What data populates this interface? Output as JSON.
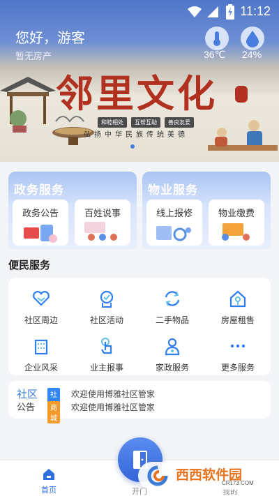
{
  "status_bar": {
    "time": "11:12"
  },
  "header": {
    "greeting": "您好，游客",
    "subtitle": "暂无房产",
    "temperature": "36℃",
    "humidity": "24%"
  },
  "banner": {
    "title": "邻里文化",
    "tags": [
      "和睦相处",
      "互帮互助",
      "善良友爱"
    ],
    "subtitle": "弘扬中华民族传统美德",
    "active_slide": 1
  },
  "services": {
    "government": {
      "title": "政务服务",
      "items": [
        {
          "label": "政务公告"
        },
        {
          "label": "百姓说事"
        }
      ]
    },
    "property": {
      "title": "物业服务",
      "items": [
        {
          "label": "线上报修"
        },
        {
          "label": "物业缴费"
        }
      ]
    }
  },
  "convenience": {
    "title": "便民服务",
    "items": [
      {
        "label": "社区周边",
        "icon": "heart-hands-icon"
      },
      {
        "label": "社区活动",
        "icon": "medal-icon"
      },
      {
        "label": "二手物品",
        "icon": "recycle-icon"
      },
      {
        "label": "房屋租售",
        "icon": "house-rent-icon"
      },
      {
        "label": "企业风采",
        "icon": "building-icon"
      },
      {
        "label": "业主报事",
        "icon": "hand-tap-icon"
      },
      {
        "label": "家政服务",
        "icon": "worker-icon"
      },
      {
        "label": "更多服务",
        "icon": "more-dots-icon"
      }
    ],
    "icon_color": "#2f7ef0"
  },
  "notice": {
    "label_line1": "社区",
    "label_line2": "公告",
    "items": [
      {
        "tag": "社区",
        "tag_color": "#2f86f6",
        "text": "欢迎使用博雅社区管家"
      },
      {
        "tag": "商城",
        "tag_color": "#f39a2b",
        "text": "欢迎使用博雅社区管家"
      }
    ]
  },
  "bottom_nav": {
    "home": "首页",
    "open": "开门",
    "mine": "我的"
  },
  "watermark": {
    "text": "西西软件园",
    "url": "CR173.COM"
  }
}
